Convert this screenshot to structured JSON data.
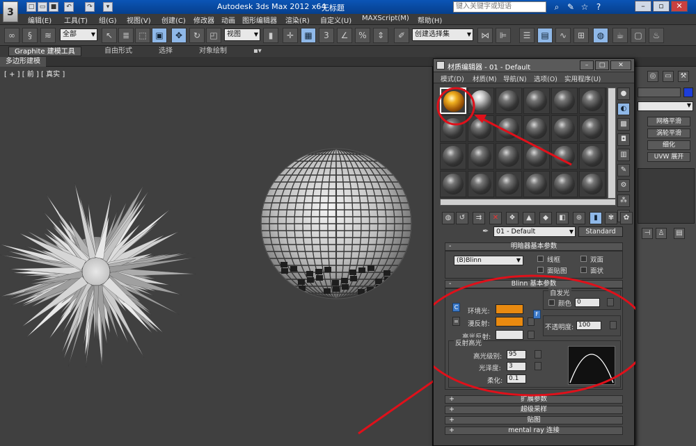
{
  "app": {
    "title": "Autodesk 3ds Max  2012 x64",
    "file": "无标题",
    "search_placeholder": "键入关键字或短语"
  },
  "menu": [
    "编辑(E)",
    "工具(T)",
    "组(G)",
    "视图(V)",
    "创建(C)",
    "修改器",
    "动画",
    "图形编辑器",
    "渲染(R)",
    "自定义(U)",
    "MAXScript(M)",
    "帮助(H)"
  ],
  "toolbar": {
    "selection_filter": "全部",
    "ref_coord": "视图",
    "named_selection": "创建选择集"
  },
  "ribbon": {
    "tabs": [
      "Graphite 建模工具",
      "自由形式",
      "选择",
      "对象绘制"
    ],
    "subtab": "多边形建模"
  },
  "viewport": {
    "label": "[ + ] [ 前 ] [ 真实 ]"
  },
  "command_panel": {
    "buttons": [
      "网格平滑",
      "涡轮平滑",
      "细化",
      "UVW 展开"
    ]
  },
  "material_editor": {
    "title": "材质编辑器 - 01 - Default",
    "menu": [
      "模式(D)",
      "材质(M)",
      "导航(N)",
      "选项(O)",
      "实用程序(U)"
    ],
    "material_name": "01 - Default",
    "material_type": "Standard",
    "shader_rollout": {
      "title": "明暗器基本参数",
      "shader": "(B)Blinn",
      "wire": "线框",
      "two_sided": "双面",
      "face_map": "面贴图",
      "faceted": "面状"
    },
    "blinn_rollout": {
      "title": "Blinn 基本参数",
      "self_illum": "自发光",
      "color_label": "颜色",
      "color_value": "0",
      "ambient": "环境光:",
      "diffuse": "漫反射:",
      "specular": "高光反射:",
      "opacity_label": "不透明度:",
      "opacity_value": "100",
      "ambient_color": "#e98a10",
      "diffuse_color": "#e98a10",
      "specular_color": "#e6e6e6"
    },
    "specular_highlights": {
      "title": "反射高光",
      "level_label": "高光级别:",
      "level_value": "95",
      "gloss_label": "光泽度:",
      "gloss_value": "3",
      "soften_label": "柔化:",
      "soften_value": "0.1"
    },
    "rollouts": [
      "扩展参数",
      "超级采样",
      "贴图",
      "mental ray 连接"
    ]
  },
  "colors": {
    "annotation": "#e0101a",
    "title_blue": "#0b55b6"
  }
}
